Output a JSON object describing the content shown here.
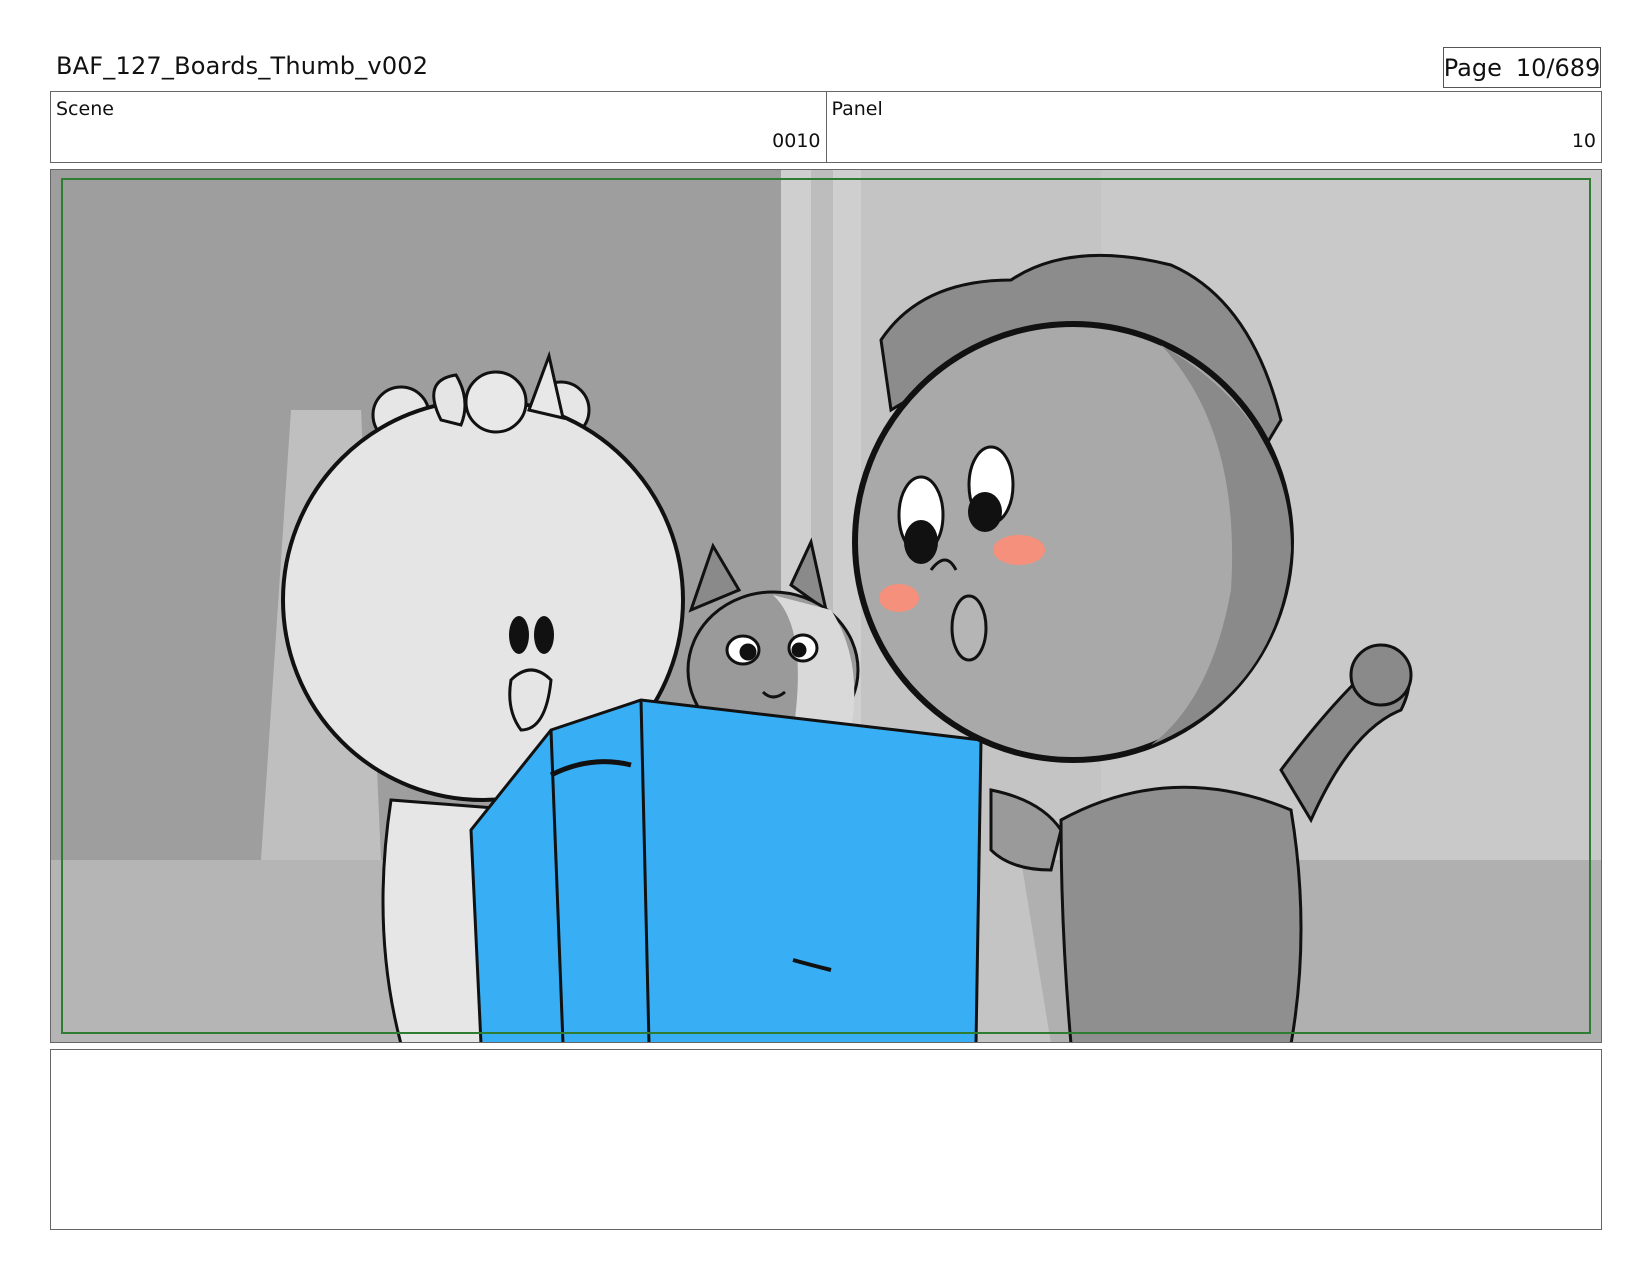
{
  "document": {
    "title": "BAF_127_Boards_Thumb_v002",
    "page_label": "Page",
    "page_number": "10/689"
  },
  "info": {
    "scene_label": "Scene",
    "scene_value": "0010",
    "panel_label": "Panel",
    "panel_value": "10"
  },
  "colors": {
    "safe_area_border": "#2e7d32",
    "monitor_blue": "#38aef5",
    "blush": "#f4907b"
  },
  "notes": {
    "text": ""
  }
}
